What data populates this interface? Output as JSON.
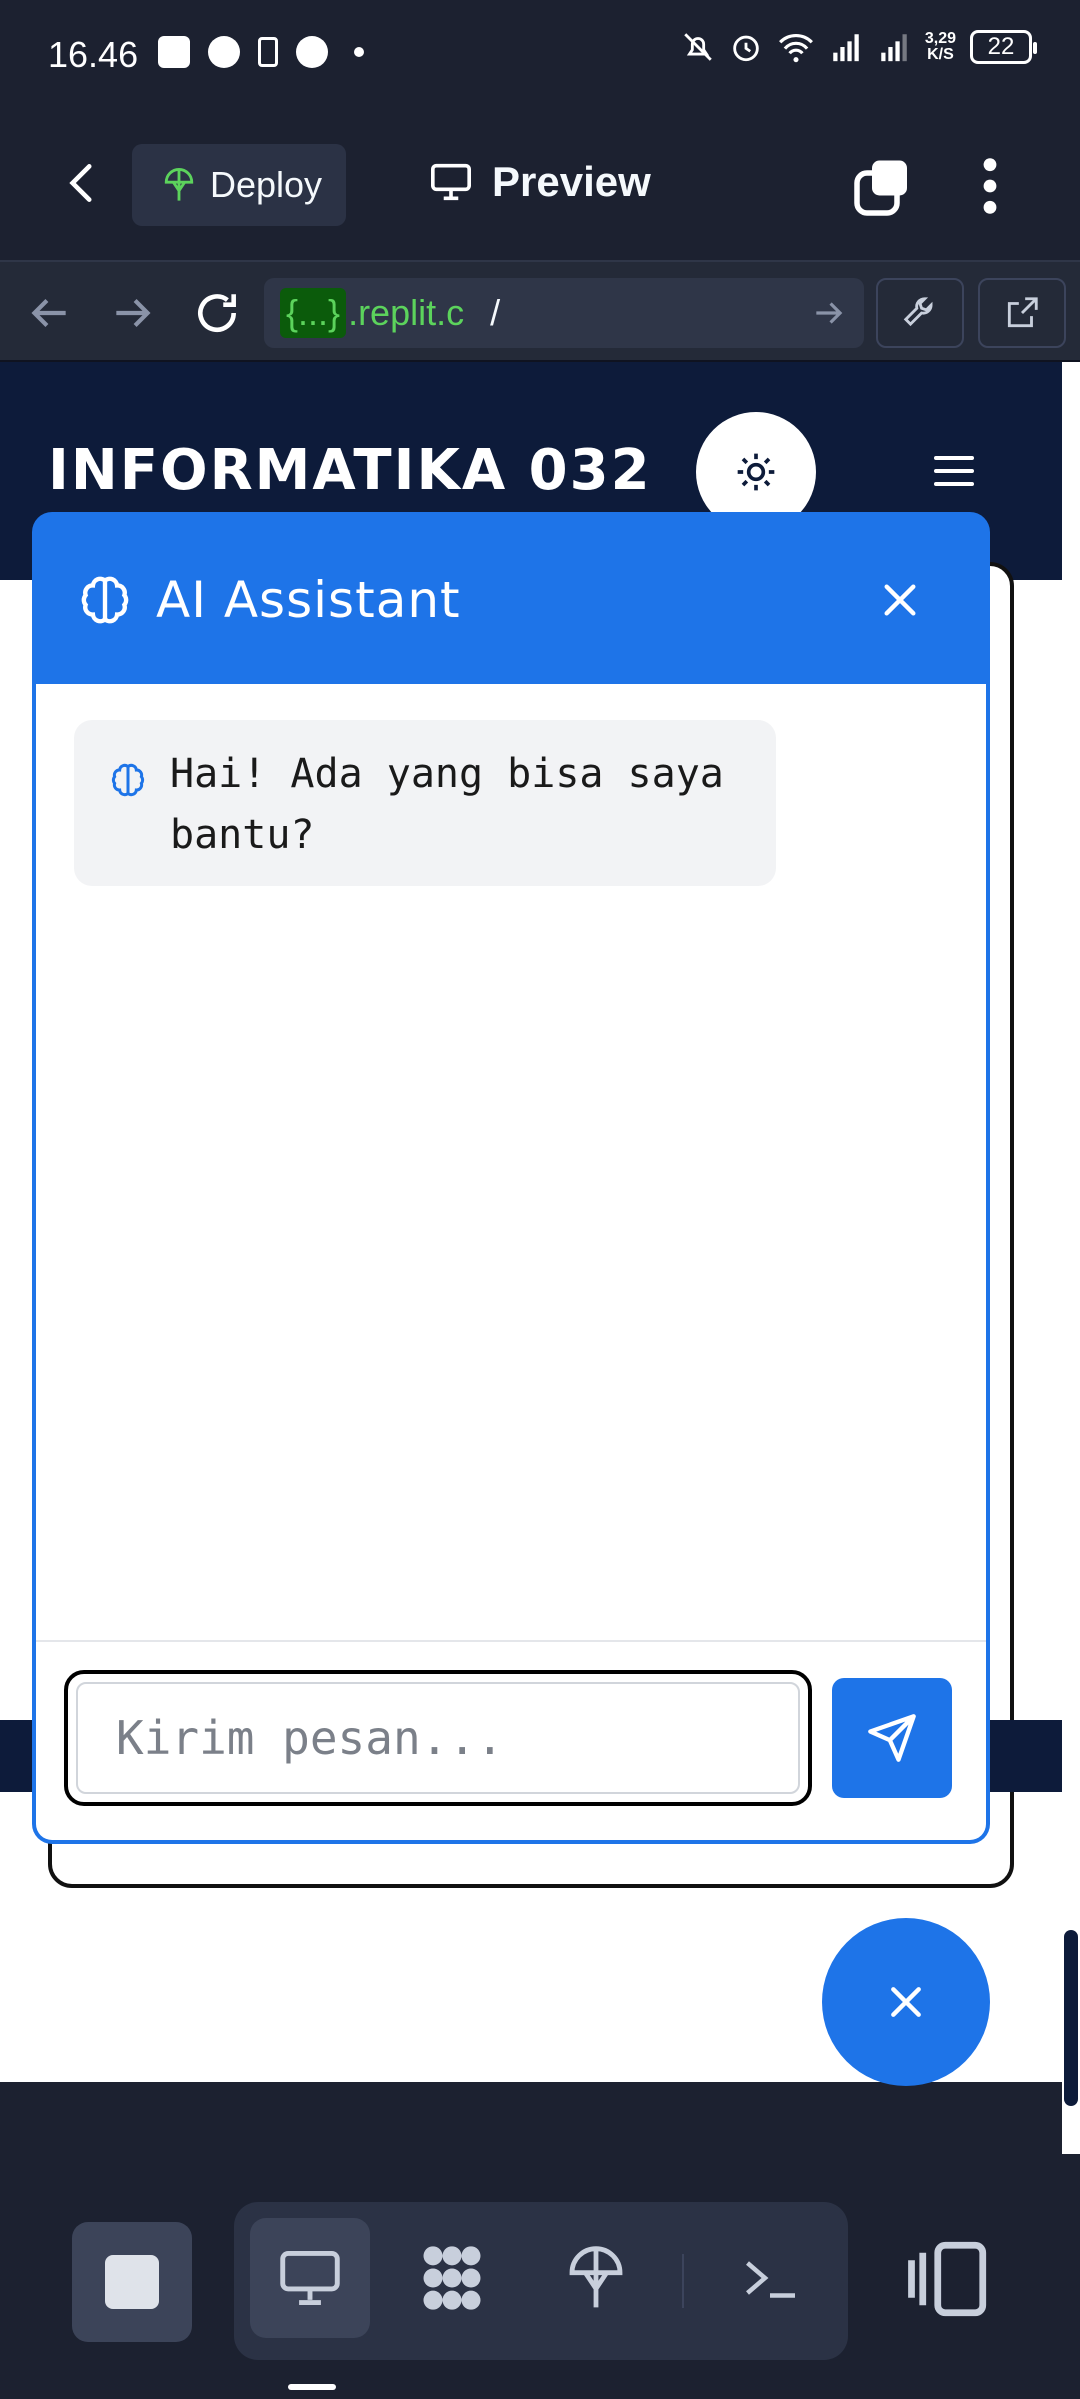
{
  "status_bar": {
    "time": "16.46",
    "network_speed_value": "3,29",
    "network_speed_unit": "K/S",
    "battery": "22"
  },
  "toolbar": {
    "deploy_label": "Deploy",
    "preview_label": "Preview"
  },
  "browser": {
    "url_chip": "{...}",
    "url_host": ".replit.c",
    "url_path": "/"
  },
  "page": {
    "site_title": "INFORMATIKA 032"
  },
  "chat": {
    "title": "AI Assistant",
    "messages": [
      {
        "from": "assistant",
        "text": "Hai! Ada yang bisa saya bantu?"
      }
    ],
    "input_placeholder": "Kirim pesan..."
  },
  "colors": {
    "accent": "#1e74e8",
    "site_header": "#0d1b3a",
    "app_chrome": "#1c2130",
    "url_green": "#5cd35c"
  }
}
